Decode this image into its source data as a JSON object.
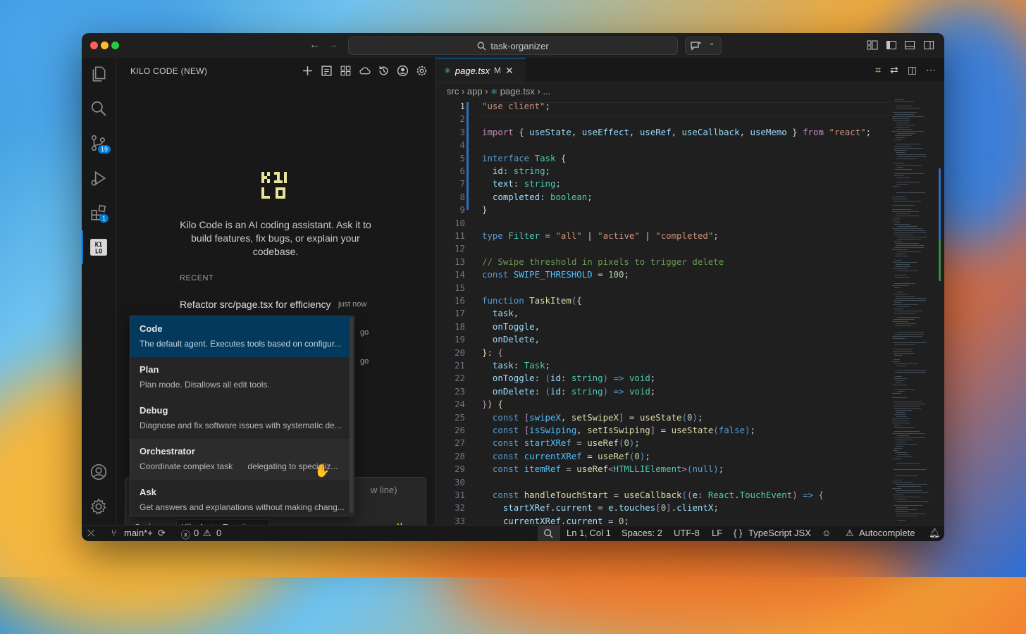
{
  "window": {
    "search_text": "task-organizer"
  },
  "activity_bar": {
    "items": [
      {
        "icon": "files-icon"
      },
      {
        "icon": "search-icon"
      },
      {
        "icon": "source-control-icon",
        "badge": "19"
      },
      {
        "icon": "run-debug-icon"
      },
      {
        "icon": "extensions-icon",
        "badge": "1"
      },
      {
        "icon": "kilo-icon"
      }
    ],
    "bottom": [
      {
        "icon": "account-icon"
      },
      {
        "icon": "settings-gear-icon"
      }
    ]
  },
  "sidebar": {
    "title": "KILO CODE (NEW)",
    "tools": [
      "plus-icon",
      "new-window-icon",
      "marketplace-icon",
      "cloud-icon",
      "history-icon",
      "profile-icon",
      "gear-icon"
    ],
    "description": "Kilo Code is an AI coding assistant. Ask it to build features, fix bugs, or explain your codebase.",
    "recent_label": "RECENT",
    "recent_items": [
      {
        "title": "Refactor src/page.tsx for efficiency",
        "time": "just now"
      }
    ],
    "partial_texts": [
      "go",
      "go"
    ],
    "input_placeholder_fragment": "w line)",
    "mode_button": "Code",
    "model_button": "Kilo Auto: Frontier",
    "modes": [
      {
        "name": "Code",
        "desc": "The default agent. Executes tools based on configur..."
      },
      {
        "name": "Plan",
        "desc": "Plan mode. Disallows all edit tools."
      },
      {
        "name": "Debug",
        "desc": "Diagnose and fix software issues with systematic de..."
      },
      {
        "name": "Orchestrator",
        "desc": "Coordinate complex tasks by delegating to specializ..."
      },
      {
        "name": "Ask",
        "desc": "Get answers and explanations without making chang..."
      }
    ],
    "orchestrator_desc_visible": "Coordinate complex task",
    "orchestrator_desc_rest": " delegating to specializ..."
  },
  "editor": {
    "tab": {
      "name": "page.tsx",
      "modified": "M"
    },
    "breadcrumb": [
      "src",
      "app",
      "page.tsx",
      "..."
    ],
    "lines": [
      "1",
      "2",
      "3",
      "4",
      "5",
      "6",
      "7",
      "8",
      "9",
      "10",
      "11",
      "12",
      "13",
      "14",
      "15",
      "16",
      "17",
      "18",
      "19",
      "20",
      "21",
      "22",
      "23",
      "24",
      "25",
      "26",
      "27",
      "28",
      "29",
      "30",
      "31",
      "32",
      "33"
    ]
  },
  "statusbar": {
    "branch": "main*+",
    "errors": "0",
    "warnings": "0",
    "position": "Ln 1, Col 1",
    "spaces": "Spaces: 2",
    "encoding": "UTF-8",
    "eol": "LF",
    "language": "TypeScript JSX",
    "autocomplete": "Autocomplete"
  }
}
